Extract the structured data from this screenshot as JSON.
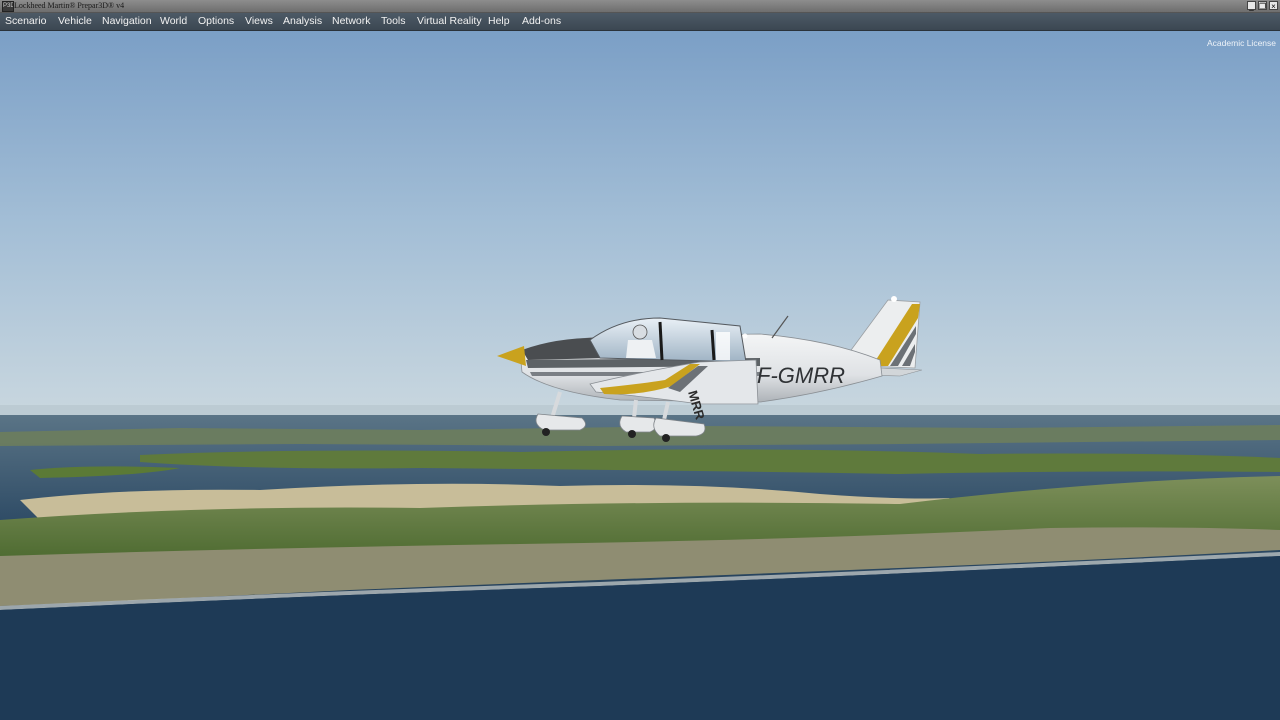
{
  "window": {
    "title": "Lockheed Martin® Prepar3D® v4",
    "icon": "p3d-app-icon",
    "controls": [
      "minimize-icon",
      "restore-icon",
      "close-icon"
    ]
  },
  "menu": [
    {
      "label": "Scenario"
    },
    {
      "label": "Vehicle"
    },
    {
      "label": "Navigation"
    },
    {
      "label": "World"
    },
    {
      "label": "Options"
    },
    {
      "label": "Views"
    },
    {
      "label": "Analysis"
    },
    {
      "label": "Network"
    },
    {
      "label": "Tools"
    },
    {
      "label": "Virtual Reality"
    },
    {
      "label": "Help"
    },
    {
      "label": "Add-ons"
    }
  ],
  "overlay": {
    "license": "Academic License"
  },
  "aircraft": {
    "registration": "F-GMRR",
    "registration_partial": "MRR",
    "livery_accent": "#c9a21e",
    "body_color": "#e6e8ea"
  },
  "colors": {
    "menubar": "#44505c",
    "sky_top": "#7ea0c6",
    "sea": "#1f3a52",
    "land": "#5e7a3a"
  }
}
